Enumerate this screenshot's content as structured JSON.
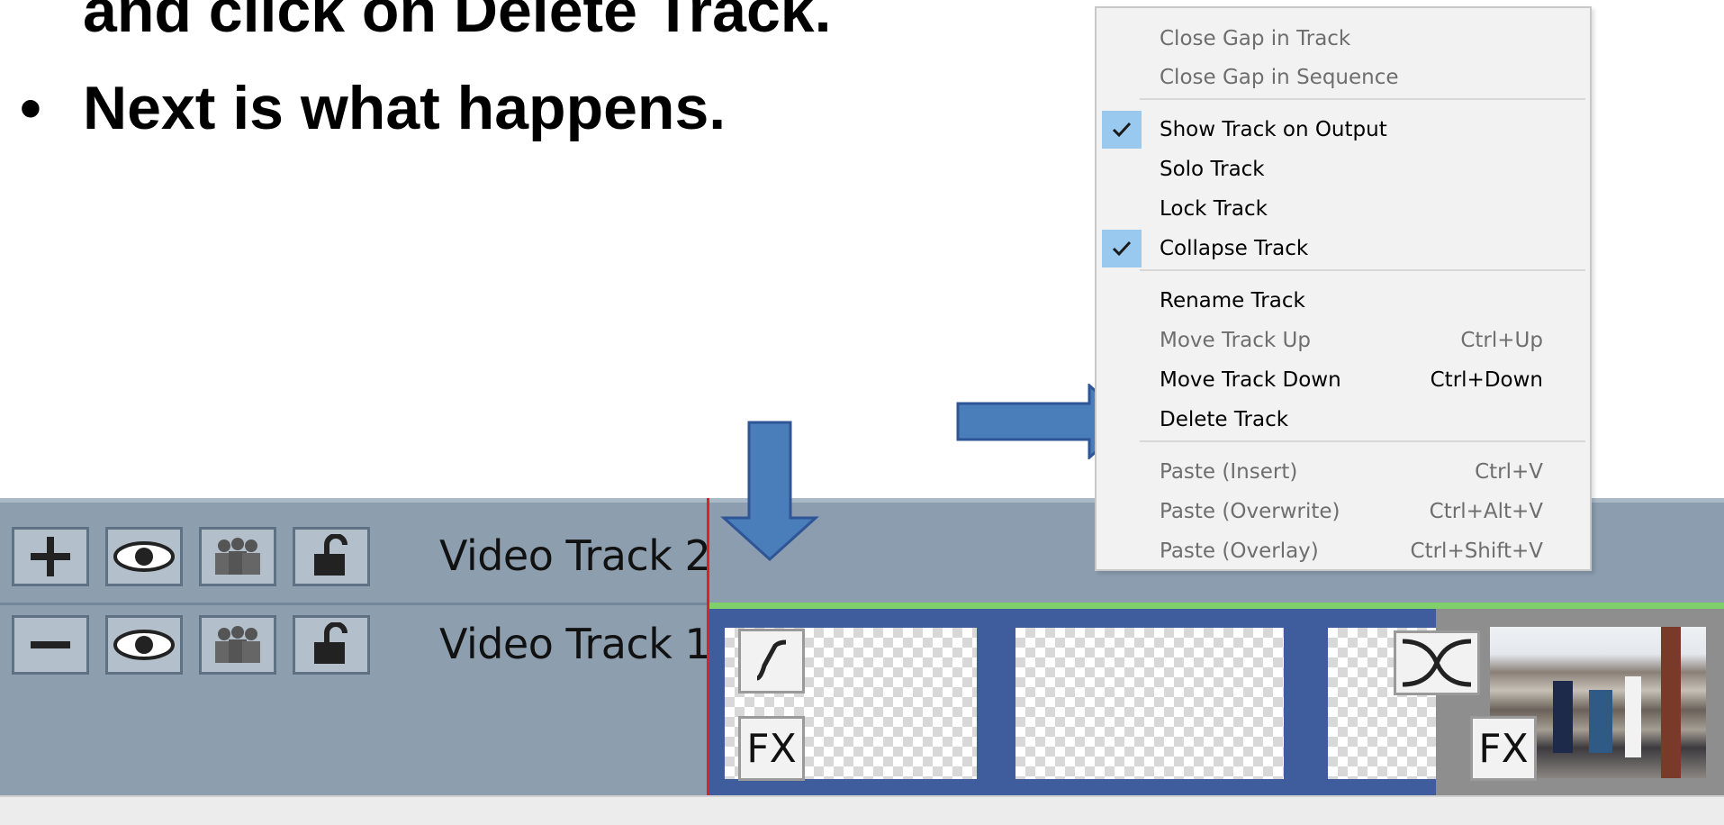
{
  "slide": {
    "line1": "and click on Delete Track.",
    "bullet": "•",
    "line2": "Next is what happens."
  },
  "tracks": [
    {
      "label": "Video Track 2",
      "add_remove_icon": "plus-icon"
    },
    {
      "label": "Video Track 1",
      "add_remove_icon": "minus-icon"
    }
  ],
  "clips": {
    "fade_icon": "fade-curve-icon",
    "fx_label": "FX",
    "transition_icon": "crossfade-icon"
  },
  "context_menu": {
    "items": [
      {
        "label": "Close Gap in Track",
        "shortcut": "",
        "enabled": false,
        "checked": false
      },
      {
        "label": "Close Gap in Sequence",
        "shortcut": "",
        "enabled": false,
        "checked": false
      },
      {
        "label": "Show Track on Output",
        "shortcut": "",
        "enabled": true,
        "checked": true
      },
      {
        "label": "Solo Track",
        "shortcut": "",
        "enabled": true,
        "checked": false
      },
      {
        "label": "Lock Track",
        "shortcut": "",
        "enabled": true,
        "checked": false
      },
      {
        "label": "Collapse Track",
        "shortcut": "",
        "enabled": true,
        "checked": true
      },
      {
        "label": "Rename Track",
        "shortcut": "",
        "enabled": true,
        "checked": false
      },
      {
        "label": "Move Track Up",
        "shortcut": "Ctrl+Up",
        "enabled": false,
        "checked": false
      },
      {
        "label": "Move Track Down",
        "shortcut": "Ctrl+Down",
        "enabled": true,
        "checked": false
      },
      {
        "label": "Delete Track",
        "shortcut": "",
        "enabled": true,
        "checked": false
      },
      {
        "label": "Paste (Insert)",
        "shortcut": "Ctrl+V",
        "enabled": false,
        "checked": false
      },
      {
        "label": "Paste (Overwrite)",
        "shortcut": "Ctrl+Alt+V",
        "enabled": false,
        "checked": false
      },
      {
        "label": "Paste (Overlay)",
        "shortcut": "Ctrl+Shift+V",
        "enabled": false,
        "checked": false
      }
    ]
  },
  "colors": {
    "arrow_fill": "#4a7ebb",
    "arrow_stroke": "#2f5597",
    "check_highlight": "#99c9ef",
    "track_background": "#8b9daf",
    "clip_blue": "#3f5d9c",
    "playhead": "#e02020",
    "green_line": "#7fcf6a"
  }
}
